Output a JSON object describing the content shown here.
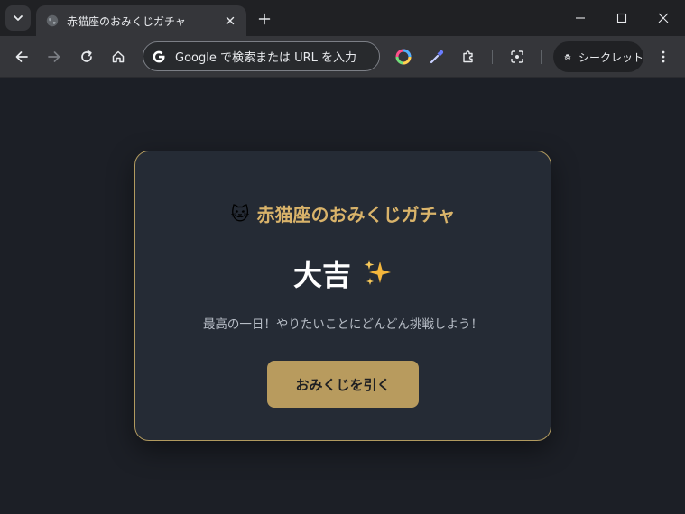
{
  "browser": {
    "tab": {
      "title": "赤猫座のおみくじガチャ",
      "favicon": "globe-icon"
    },
    "omnibox": {
      "placeholder": "Google で検索または URL を入力"
    },
    "incognito": {
      "label": "シークレット"
    }
  },
  "page": {
    "heading_emoji": "🐱",
    "title": "赤猫座のおみくじガチャ",
    "result": "大吉",
    "message": "最高の一日！やりたいことにどんどん挑戦しよう！",
    "button_label": "おみくじを引く"
  },
  "colors": {
    "accent": "#d9b36a",
    "button": "#b89b5e",
    "card_bg": "#252b35",
    "page_bg": "#1c1f26"
  }
}
